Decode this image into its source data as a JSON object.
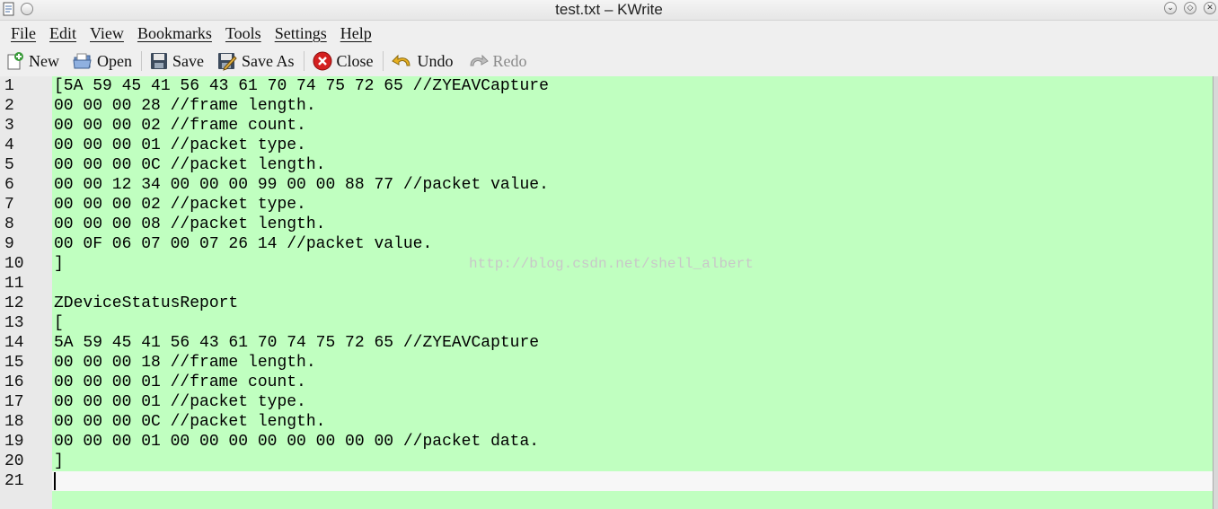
{
  "window": {
    "title": "test.txt – KWrite"
  },
  "menubar": {
    "items": [
      {
        "label": "File"
      },
      {
        "label": "Edit"
      },
      {
        "label": "View"
      },
      {
        "label": "Bookmarks"
      },
      {
        "label": "Tools"
      },
      {
        "label": "Settings"
      },
      {
        "label": "Help"
      }
    ]
  },
  "toolbar": {
    "new_label": "New",
    "open_label": "Open",
    "save_label": "Save",
    "save_as_label": "Save As",
    "close_label": "Close",
    "undo_label": "Undo",
    "redo_label": "Redo",
    "redo_enabled": false
  },
  "editor": {
    "background_color": "#c0ffc0",
    "current_line_color": "#f7f7f7",
    "current_line": 21,
    "watermark": "http://blog.csdn.net/shell_albert",
    "lines": [
      {
        "num": "1",
        "text": "[5A 59 45 41 56 43 61 70 74 75 72 65 //ZYEAVCapture"
      },
      {
        "num": "2",
        "text": "00 00 00 28 //frame length."
      },
      {
        "num": "3",
        "text": "00 00 00 02 //frame count."
      },
      {
        "num": "4",
        "text": "00 00 00 01 //packet type."
      },
      {
        "num": "5",
        "text": "00 00 00 0C //packet length."
      },
      {
        "num": "6",
        "text": "00 00 12 34 00 00 00 99 00 00 88 77 //packet value."
      },
      {
        "num": "7",
        "text": "00 00 00 02 //packet type."
      },
      {
        "num": "8",
        "text": "00 00 00 08 //packet length."
      },
      {
        "num": "9",
        "text": "00 0F 06 07 00 07 26 14 //packet value."
      },
      {
        "num": "10",
        "text": "]"
      },
      {
        "num": "11",
        "text": ""
      },
      {
        "num": "12",
        "text": "ZDeviceStatusReport"
      },
      {
        "num": "13",
        "text": "["
      },
      {
        "num": "14",
        "text": "5A 59 45 41 56 43 61 70 74 75 72 65 //ZYEAVCapture"
      },
      {
        "num": "15",
        "text": "00 00 00 18 //frame length."
      },
      {
        "num": "16",
        "text": "00 00 00 01 //frame count."
      },
      {
        "num": "17",
        "text": "00 00 00 01 //packet type."
      },
      {
        "num": "18",
        "text": "00 00 00 0C //packet length."
      },
      {
        "num": "19",
        "text": "00 00 00 01 00 00 00 00 00 00 00 00 //packet data."
      },
      {
        "num": "20",
        "text": "]"
      },
      {
        "num": "21",
        "text": ""
      }
    ]
  }
}
